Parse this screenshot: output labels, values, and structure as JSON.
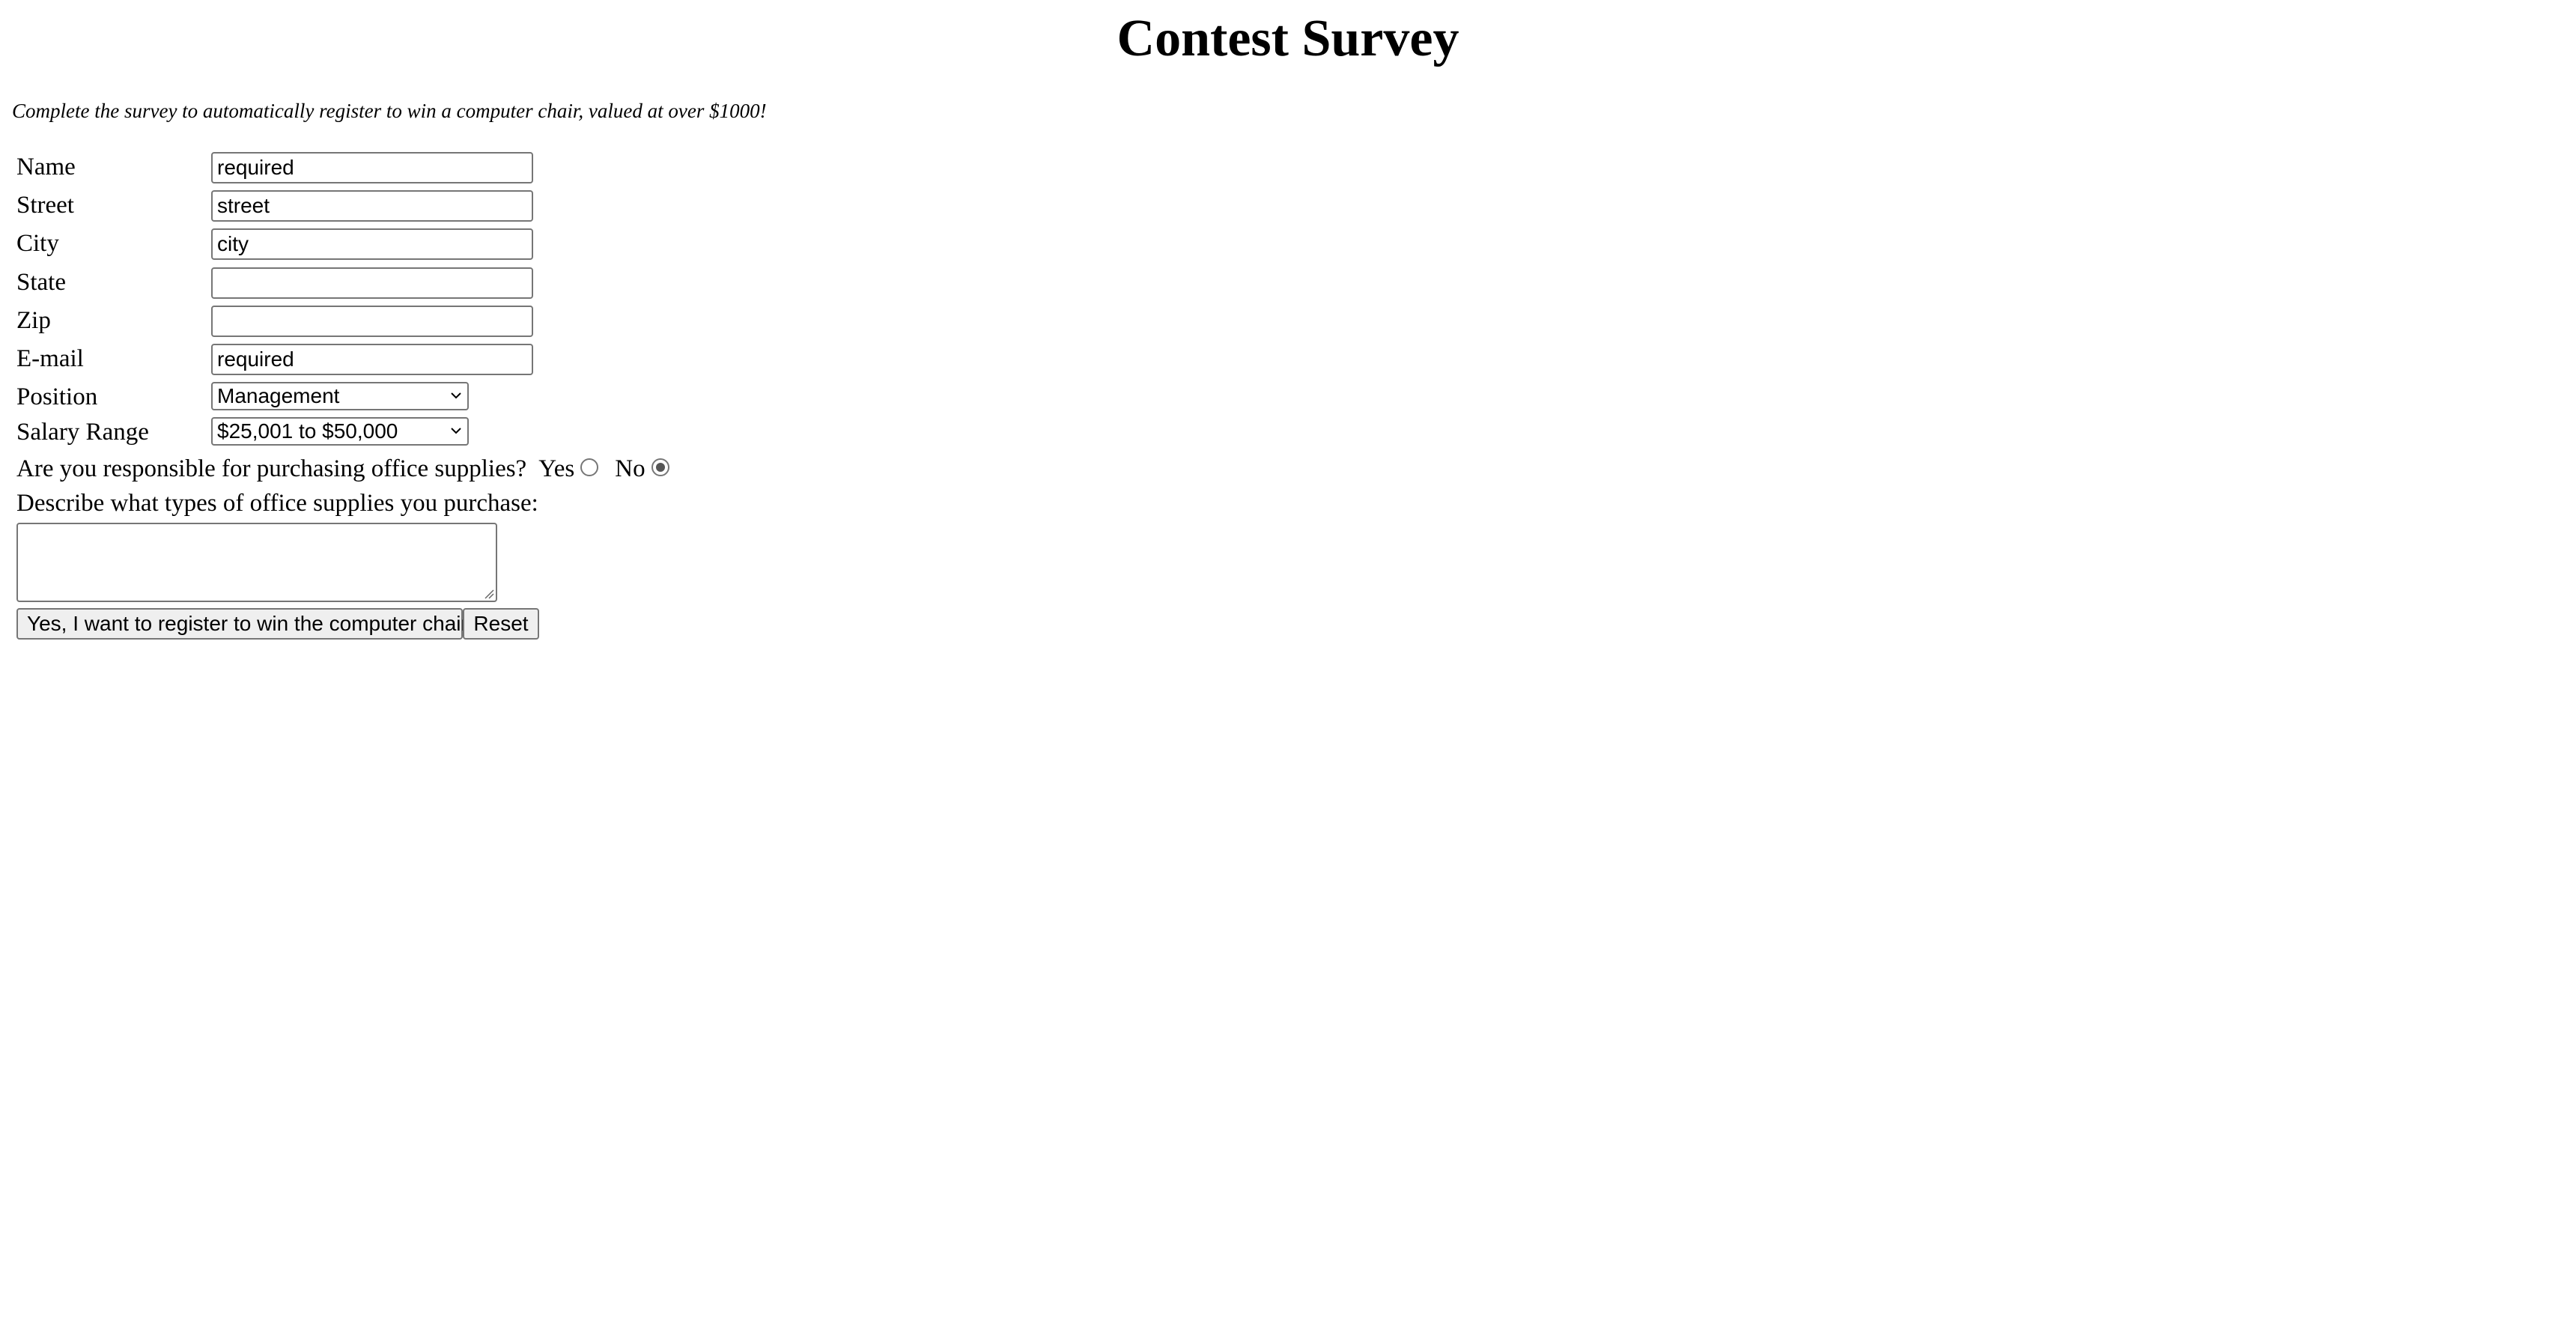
{
  "page": {
    "title": "Contest Survey",
    "intro": "Complete the survey to automatically register to win a computer chair, valued at over $1000!"
  },
  "form": {
    "fields": {
      "name": {
        "label": "Name",
        "value": "required"
      },
      "street": {
        "label": "Street",
        "value": "street"
      },
      "city": {
        "label": "City",
        "value": "city"
      },
      "state": {
        "label": "State",
        "value": ""
      },
      "zip": {
        "label": "Zip",
        "value": ""
      },
      "email": {
        "label": "E-mail",
        "value": "required"
      }
    },
    "position": {
      "label": "Position",
      "selected": "Management"
    },
    "salary": {
      "label": "Salary Range",
      "selected": "$25,001 to $50,000"
    },
    "purchasing": {
      "question": "Are you responsible for purchasing office supplies?",
      "yes_label": "Yes",
      "no_label": "No",
      "selected": "No"
    },
    "describe": {
      "label": "Describe what types of office supplies you purchase:",
      "value": ""
    },
    "buttons": {
      "submit_label": "Yes, I want to register to win the computer chair",
      "reset_label": "Reset"
    }
  },
  "icons": {
    "select_arrow": "chevron-down-icon",
    "textarea_resize": "resize-grip-icon"
  }
}
